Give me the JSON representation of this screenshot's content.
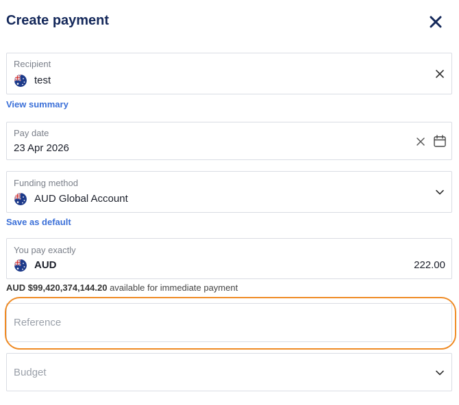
{
  "header": {
    "title": "Create payment",
    "close_icon": "close-icon"
  },
  "recipient": {
    "label": "Recipient",
    "value": "test",
    "flag": "australia-flag-icon"
  },
  "view_summary": "View summary",
  "pay_date": {
    "label": "Pay date",
    "value": "23 Apr 2026"
  },
  "funding_method": {
    "label": "Funding method",
    "value": "AUD Global Account",
    "flag": "australia-flag-icon"
  },
  "save_default": "Save as default",
  "you_pay": {
    "label": "You pay exactly",
    "currency": "AUD",
    "amount": "222.00"
  },
  "available": {
    "amount": "AUD $99,420,374,144.20",
    "suffix": " available for immediate payment"
  },
  "reference": {
    "placeholder": "Reference"
  },
  "budget": {
    "placeholder": "Budget"
  },
  "colors": {
    "title": "#14285a",
    "link": "#3a6fd8",
    "highlight": "#ef8a23",
    "border": "#d9dce3"
  }
}
